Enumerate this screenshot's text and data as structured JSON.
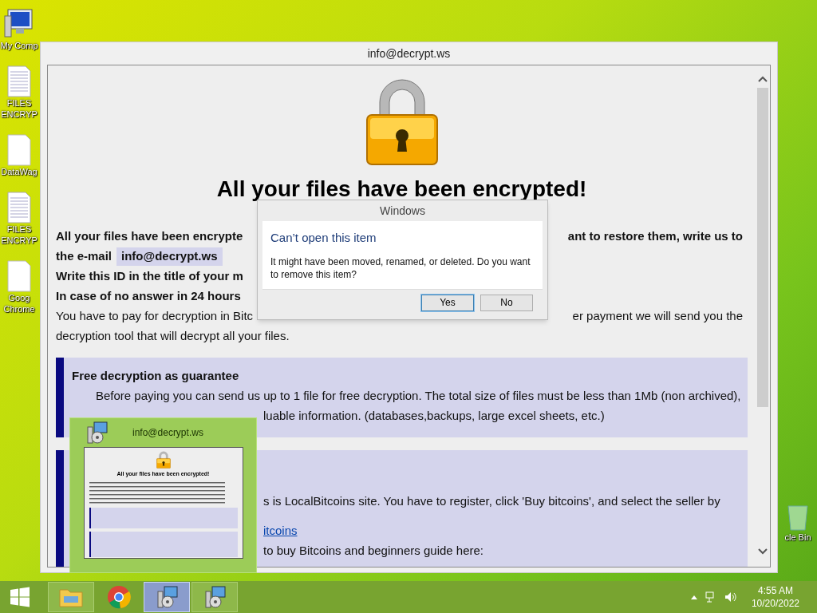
{
  "desktop_icons": [
    {
      "kind": "computer",
      "lines": [
        "My Comp"
      ]
    },
    {
      "kind": "text-file",
      "lines": [
        "FILES",
        "ENCRYP"
      ]
    },
    {
      "kind": "blank-file",
      "lines": [
        "DataWag"
      ]
    },
    {
      "kind": "text-file",
      "lines": [
        "FILES",
        "ENCRYP"
      ]
    },
    {
      "kind": "blank-file",
      "lines": [
        "Goog",
        "Chrome"
      ]
    },
    {
      "kind": "recycle-bin",
      "lines": [
        "cle Bin"
      ]
    }
  ],
  "window": {
    "title": "info@decrypt.ws",
    "heading": "All your files have been encrypted!",
    "lines": [
      {
        "left": "All your files have been encrypte",
        "right": "ant to restore them, write us to",
        "bold": true
      },
      {
        "left": "the e-mail",
        "email": "info@decrypt.ws",
        "bold": true
      },
      {
        "left": "Write this ID in the title of your m",
        "bold": true
      },
      {
        "left": "In case of no answer in 24 hours",
        "bold": true
      },
      {
        "left": "You have to pay for decryption in Bitc",
        "right": "er payment we will send you the",
        "bold": false
      },
      {
        "left": "decryption tool that will decrypt all your files.",
        "bold": false
      }
    ],
    "boxes": [
      {
        "title": "Free decryption as guarantee",
        "lines": [
          {
            "text": "Before paying you can send us up to 1 file for free decryption. The total size of files must be less than 1Mb (non archived),",
            "kind": "text"
          },
          {
            "text": "luable information. (databases,backups, large excel sheets, etc.)",
            "kind": "text"
          }
        ]
      },
      {
        "lines": [
          {
            "text": "s is LocalBitcoins site. You have to register, click 'Buy bitcoins', and select the seller by",
            "kind": "text"
          },
          {
            "text": "itcoins",
            "kind": "link"
          },
          {
            "text": "to buy Bitcoins and beginners guide here:",
            "kind": "text"
          }
        ]
      }
    ]
  },
  "dialog": {
    "title": "Windows",
    "heading": "Can’t open this item",
    "message": "It might have been moved, renamed, or deleted. Do you want to remove this item?",
    "buttons": [
      {
        "label": "Yes",
        "default": true
      },
      {
        "label": "No",
        "default": false
      }
    ]
  },
  "thumbnail": {
    "title": "info@decrypt.ws",
    "preview_heading": "All your files have been encrypted!"
  },
  "taskbar": {
    "items": [
      {
        "kind": "folder",
        "selected": false
      },
      {
        "kind": "chrome",
        "selected": false
      },
      {
        "kind": "installer",
        "selected": true
      },
      {
        "kind": "installer",
        "selected": false
      }
    ],
    "time": "4:55 AM",
    "date": "10/20/2022"
  }
}
